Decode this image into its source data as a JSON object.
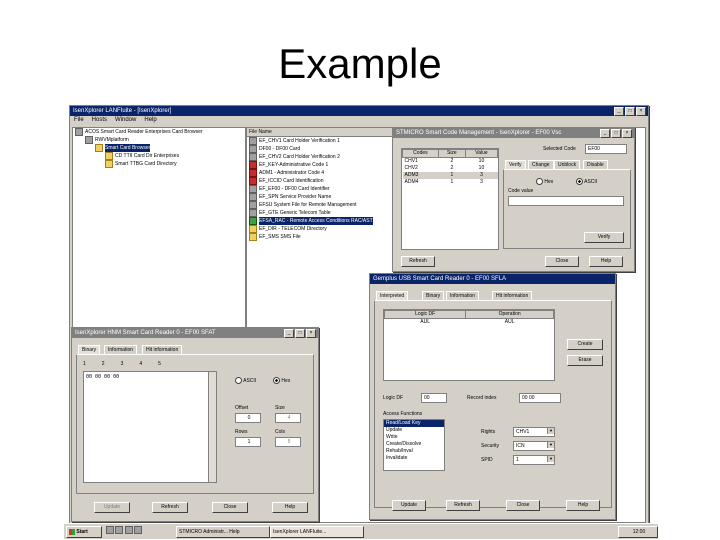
{
  "slide": {
    "title": "Example"
  },
  "main_window": {
    "title": "IsenXplorer LANFIuite - [IsenXplorer]",
    "menu": [
      "File",
      "Hosts",
      "Window",
      "Help"
    ],
    "tree_root": "ACOS Smart Card Reader Enterprises Card Browser",
    "tree_items": [
      "RWVMplatform",
      "Smart Card Browser",
      "CD TTII Card Dir Enterprises",
      "Smart TTBG Card Directory"
    ],
    "list_header": "File Name",
    "list_items": [
      {
        "label": "EF_CHV1 Card Holder Verification 1",
        "icon": "gray"
      },
      {
        "label": "DF00 - DF00 Card",
        "icon": "gray"
      },
      {
        "label": "EF_CHV2 Card Holder Verification 2",
        "icon": "gray"
      },
      {
        "label": "EF_KEY-Administrative Code 1",
        "icon": "red"
      },
      {
        "label": "ADM1 - Administrator Code 4",
        "icon": "red"
      },
      {
        "label": "EF_ICCID Card Identification",
        "icon": "red"
      },
      {
        "label": "EF_EF00 - DF00 Card Identifier",
        "icon": "gray"
      },
      {
        "label": "EF_SPN Service Provider Name",
        "icon": "gray"
      },
      {
        "label": "EFSU System File for Remote Management",
        "icon": "gray"
      },
      {
        "label": "EF_GTE Generic Telecom Table",
        "icon": "gray"
      },
      {
        "label": "EFSA_RAC - Remote Access Conditions RAC/AST",
        "icon": "green",
        "selected": true
      },
      {
        "label": "EF_DIR - TELECOM Directory",
        "icon": "folder"
      },
      {
        "label": "EF_SMS SMS File",
        "icon": "folder"
      }
    ]
  },
  "mgmt_window": {
    "title": "STMICRO Smart Code Management - IsenXplorer - EF00 Vsc",
    "columns": [
      "Codes",
      "Size",
      "Value"
    ],
    "rows": [
      [
        "CHV1",
        "2",
        "10"
      ],
      [
        "CHV2",
        "2",
        "10"
      ],
      [
        "ADM3",
        "1",
        "3"
      ],
      [
        "ADM4",
        "1",
        "3"
      ]
    ],
    "selected_code_label": "Selected Code",
    "selected_code_value": "EF00",
    "tabs": [
      "Verify",
      "Change",
      "Unblock",
      "Disable"
    ],
    "radio_hex": "Hex",
    "radio_ascii": "ASCII",
    "code_value_label": "Code value",
    "verify_btn": "Verify",
    "refresh_btn": "Refresh",
    "close_btn": "Close",
    "help_btn": "Help"
  },
  "reader_window": {
    "title": "Gemplus USB Smart Card Reader 0 - EF00 SFLA",
    "tabs": [
      "Interpreted",
      "Binary",
      "Information",
      "Hit information"
    ],
    "columns": [
      "Logic DF",
      "Operation"
    ],
    "row": [
      "AUL",
      "AUL"
    ],
    "create_btn": "Create",
    "erase_btn": "Erase",
    "logic_df_label": "Logic DF",
    "logic_df_value": "00",
    "record_label": "Record index",
    "record_value": "00 00",
    "access_label": "Access Functions",
    "access_items": [
      "Read/Load Key",
      "Update",
      "Write",
      "Create/Dissolve",
      "Rehab/Inval",
      "Invalidate"
    ],
    "right_label": "Rights",
    "right_value": "CHV1",
    "security_label": "Security",
    "security_value": "ICN",
    "spid_label": "SPID",
    "spid_value": "1",
    "update_btn": "Update",
    "refresh_btn": "Refresh",
    "close_btn": "Close",
    "help_btn": "Help"
  },
  "binary_window": {
    "title": "IsenXplorer HNM Smart Card Reader 0 - EF00 SFAT",
    "tabs": [
      "Binary",
      "Information",
      "Hit information"
    ],
    "col_headers": [
      "1",
      "2",
      "3",
      "4",
      "5"
    ],
    "hex_content": "00 00 00 00",
    "radio_ascii": "ASCII",
    "radio_hex": "Hex",
    "offset_label": "Offset",
    "size_label": "Size",
    "offset_value": "0",
    "size_value": "4",
    "rows_label": "Rows",
    "cols_label": "Cols",
    "rows_value": "1",
    "cols_value": "5",
    "update_btn": "Update",
    "refresh_btn": "Refresh",
    "close_btn": "Close",
    "help_btn": "Help"
  },
  "taskbar": {
    "start": "Start",
    "items": [
      "STMICRO Administr... Help",
      "IsenXplorer LANFIuite..."
    ],
    "clock": "12:00"
  }
}
